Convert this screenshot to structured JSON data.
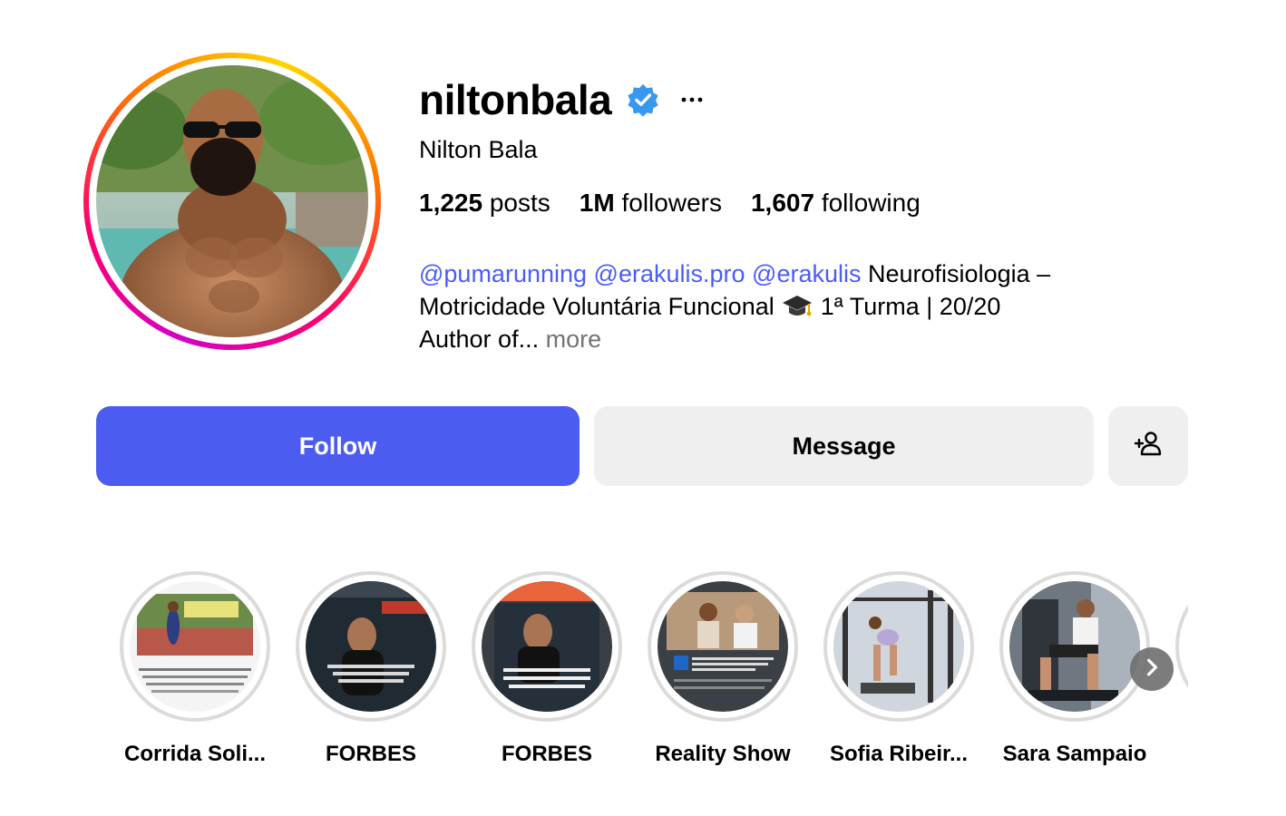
{
  "profile": {
    "username": "niltonbala",
    "full_name": "Nilton Bala",
    "verified_icon": "verified-badge-icon",
    "more_icon": "more-options-icon"
  },
  "stats": {
    "posts_value": "1,225",
    "posts_label": "posts",
    "followers_value": "1M",
    "followers_label": "followers",
    "following_value": "1,607",
    "following_label": "following"
  },
  "bio": {
    "mention_1": "@pumarunning",
    "mention_2": "@erakulis.pro",
    "mention_3": "@erakulis",
    "text_1": "Neurofisiologia –",
    "text_2": "Motricidade Voluntária Funcional",
    "text_3": "1ª Turma | 20/20",
    "text_4": "Author of...",
    "more_label": "more",
    "emoji": "graduation-cap-icon"
  },
  "actions": {
    "follow_label": "Follow",
    "message_label": "Message",
    "add_icon": "add-person-icon"
  },
  "highlights": [
    {
      "label": "Corrida Soli..."
    },
    {
      "label": "FORBES"
    },
    {
      "label": "FORBES"
    },
    {
      "label": "Reality Show"
    },
    {
      "label": "Sofia Ribeir..."
    },
    {
      "label": "Sara Sampaio"
    }
  ],
  "colors": {
    "follow_button": "#4c5bf0",
    "mention": "#4a5df5",
    "secondary_button": "#efefef",
    "verified": "#3897f0"
  }
}
